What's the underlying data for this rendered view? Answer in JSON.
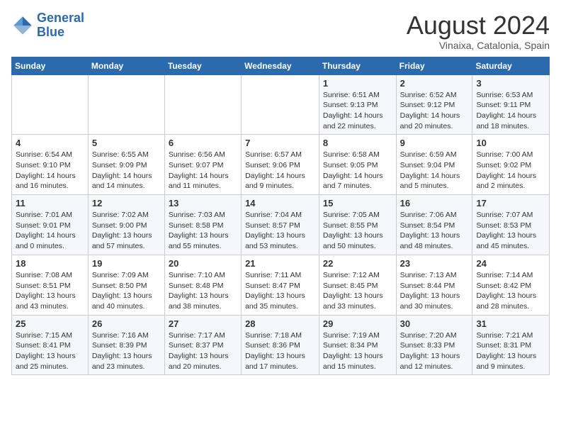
{
  "header": {
    "logo_line1": "General",
    "logo_line2": "Blue",
    "month": "August 2024",
    "location": "Vinaixa, Catalonia, Spain"
  },
  "days_of_week": [
    "Sunday",
    "Monday",
    "Tuesday",
    "Wednesday",
    "Thursday",
    "Friday",
    "Saturday"
  ],
  "weeks": [
    [
      {
        "day": "",
        "info": ""
      },
      {
        "day": "",
        "info": ""
      },
      {
        "day": "",
        "info": ""
      },
      {
        "day": "",
        "info": ""
      },
      {
        "day": "1",
        "info": "Sunrise: 6:51 AM\nSunset: 9:13 PM\nDaylight: 14 hours\nand 22 minutes."
      },
      {
        "day": "2",
        "info": "Sunrise: 6:52 AM\nSunset: 9:12 PM\nDaylight: 14 hours\nand 20 minutes."
      },
      {
        "day": "3",
        "info": "Sunrise: 6:53 AM\nSunset: 9:11 PM\nDaylight: 14 hours\nand 18 minutes."
      }
    ],
    [
      {
        "day": "4",
        "info": "Sunrise: 6:54 AM\nSunset: 9:10 PM\nDaylight: 14 hours\nand 16 minutes."
      },
      {
        "day": "5",
        "info": "Sunrise: 6:55 AM\nSunset: 9:09 PM\nDaylight: 14 hours\nand 14 minutes."
      },
      {
        "day": "6",
        "info": "Sunrise: 6:56 AM\nSunset: 9:07 PM\nDaylight: 14 hours\nand 11 minutes."
      },
      {
        "day": "7",
        "info": "Sunrise: 6:57 AM\nSunset: 9:06 PM\nDaylight: 14 hours\nand 9 minutes."
      },
      {
        "day": "8",
        "info": "Sunrise: 6:58 AM\nSunset: 9:05 PM\nDaylight: 14 hours\nand 7 minutes."
      },
      {
        "day": "9",
        "info": "Sunrise: 6:59 AM\nSunset: 9:04 PM\nDaylight: 14 hours\nand 5 minutes."
      },
      {
        "day": "10",
        "info": "Sunrise: 7:00 AM\nSunset: 9:02 PM\nDaylight: 14 hours\nand 2 minutes."
      }
    ],
    [
      {
        "day": "11",
        "info": "Sunrise: 7:01 AM\nSunset: 9:01 PM\nDaylight: 14 hours\nand 0 minutes."
      },
      {
        "day": "12",
        "info": "Sunrise: 7:02 AM\nSunset: 9:00 PM\nDaylight: 13 hours\nand 57 minutes."
      },
      {
        "day": "13",
        "info": "Sunrise: 7:03 AM\nSunset: 8:58 PM\nDaylight: 13 hours\nand 55 minutes."
      },
      {
        "day": "14",
        "info": "Sunrise: 7:04 AM\nSunset: 8:57 PM\nDaylight: 13 hours\nand 53 minutes."
      },
      {
        "day": "15",
        "info": "Sunrise: 7:05 AM\nSunset: 8:55 PM\nDaylight: 13 hours\nand 50 minutes."
      },
      {
        "day": "16",
        "info": "Sunrise: 7:06 AM\nSunset: 8:54 PM\nDaylight: 13 hours\nand 48 minutes."
      },
      {
        "day": "17",
        "info": "Sunrise: 7:07 AM\nSunset: 8:53 PM\nDaylight: 13 hours\nand 45 minutes."
      }
    ],
    [
      {
        "day": "18",
        "info": "Sunrise: 7:08 AM\nSunset: 8:51 PM\nDaylight: 13 hours\nand 43 minutes."
      },
      {
        "day": "19",
        "info": "Sunrise: 7:09 AM\nSunset: 8:50 PM\nDaylight: 13 hours\nand 40 minutes."
      },
      {
        "day": "20",
        "info": "Sunrise: 7:10 AM\nSunset: 8:48 PM\nDaylight: 13 hours\nand 38 minutes."
      },
      {
        "day": "21",
        "info": "Sunrise: 7:11 AM\nSunset: 8:47 PM\nDaylight: 13 hours\nand 35 minutes."
      },
      {
        "day": "22",
        "info": "Sunrise: 7:12 AM\nSunset: 8:45 PM\nDaylight: 13 hours\nand 33 minutes."
      },
      {
        "day": "23",
        "info": "Sunrise: 7:13 AM\nSunset: 8:44 PM\nDaylight: 13 hours\nand 30 minutes."
      },
      {
        "day": "24",
        "info": "Sunrise: 7:14 AM\nSunset: 8:42 PM\nDaylight: 13 hours\nand 28 minutes."
      }
    ],
    [
      {
        "day": "25",
        "info": "Sunrise: 7:15 AM\nSunset: 8:41 PM\nDaylight: 13 hours\nand 25 minutes."
      },
      {
        "day": "26",
        "info": "Sunrise: 7:16 AM\nSunset: 8:39 PM\nDaylight: 13 hours\nand 23 minutes."
      },
      {
        "day": "27",
        "info": "Sunrise: 7:17 AM\nSunset: 8:37 PM\nDaylight: 13 hours\nand 20 minutes."
      },
      {
        "day": "28",
        "info": "Sunrise: 7:18 AM\nSunset: 8:36 PM\nDaylight: 13 hours\nand 17 minutes."
      },
      {
        "day": "29",
        "info": "Sunrise: 7:19 AM\nSunset: 8:34 PM\nDaylight: 13 hours\nand 15 minutes."
      },
      {
        "day": "30",
        "info": "Sunrise: 7:20 AM\nSunset: 8:33 PM\nDaylight: 13 hours\nand 12 minutes."
      },
      {
        "day": "31",
        "info": "Sunrise: 7:21 AM\nSunset: 8:31 PM\nDaylight: 13 hours\nand 9 minutes."
      }
    ]
  ]
}
